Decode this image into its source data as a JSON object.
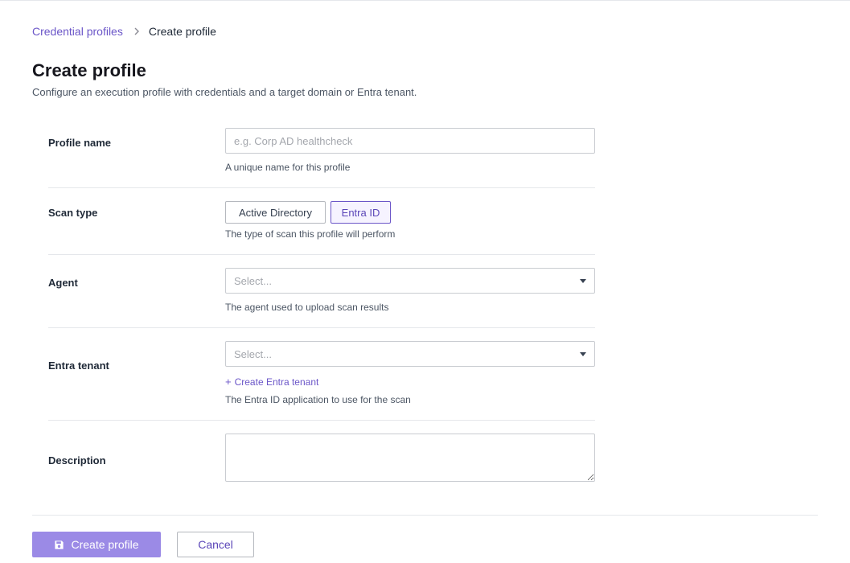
{
  "breadcrumb": {
    "parent": "Credential profiles",
    "current": "Create profile"
  },
  "header": {
    "title": "Create profile",
    "subtitle": "Configure an execution profile with credentials and a target domain or Entra tenant."
  },
  "form": {
    "profile_name": {
      "label": "Profile name",
      "placeholder": "e.g. Corp AD healthcheck",
      "value": "",
      "help": "A unique name for this profile"
    },
    "scan_type": {
      "label": "Scan type",
      "options": [
        "Active Directory",
        "Entra ID"
      ],
      "selected": "Entra ID",
      "help": "The type of scan this profile will perform"
    },
    "agent": {
      "label": "Agent",
      "placeholder": "Select...",
      "help": "The agent used to upload scan results"
    },
    "entra_tenant": {
      "label": "Entra tenant",
      "placeholder": "Select...",
      "create_link": "Create Entra tenant",
      "help": "The Entra ID application to use for the scan"
    },
    "description": {
      "label": "Description",
      "value": ""
    }
  },
  "actions": {
    "submit_label": "Create profile",
    "cancel_label": "Cancel"
  },
  "colors": {
    "accent": "#6b56c8",
    "primary_button": "#9b8ae6"
  },
  "icons": {
    "breadcrumb_separator": "chevron-right-icon",
    "select_caret": "caret-down-icon",
    "create_link": "plus-icon",
    "submit": "save-icon"
  }
}
